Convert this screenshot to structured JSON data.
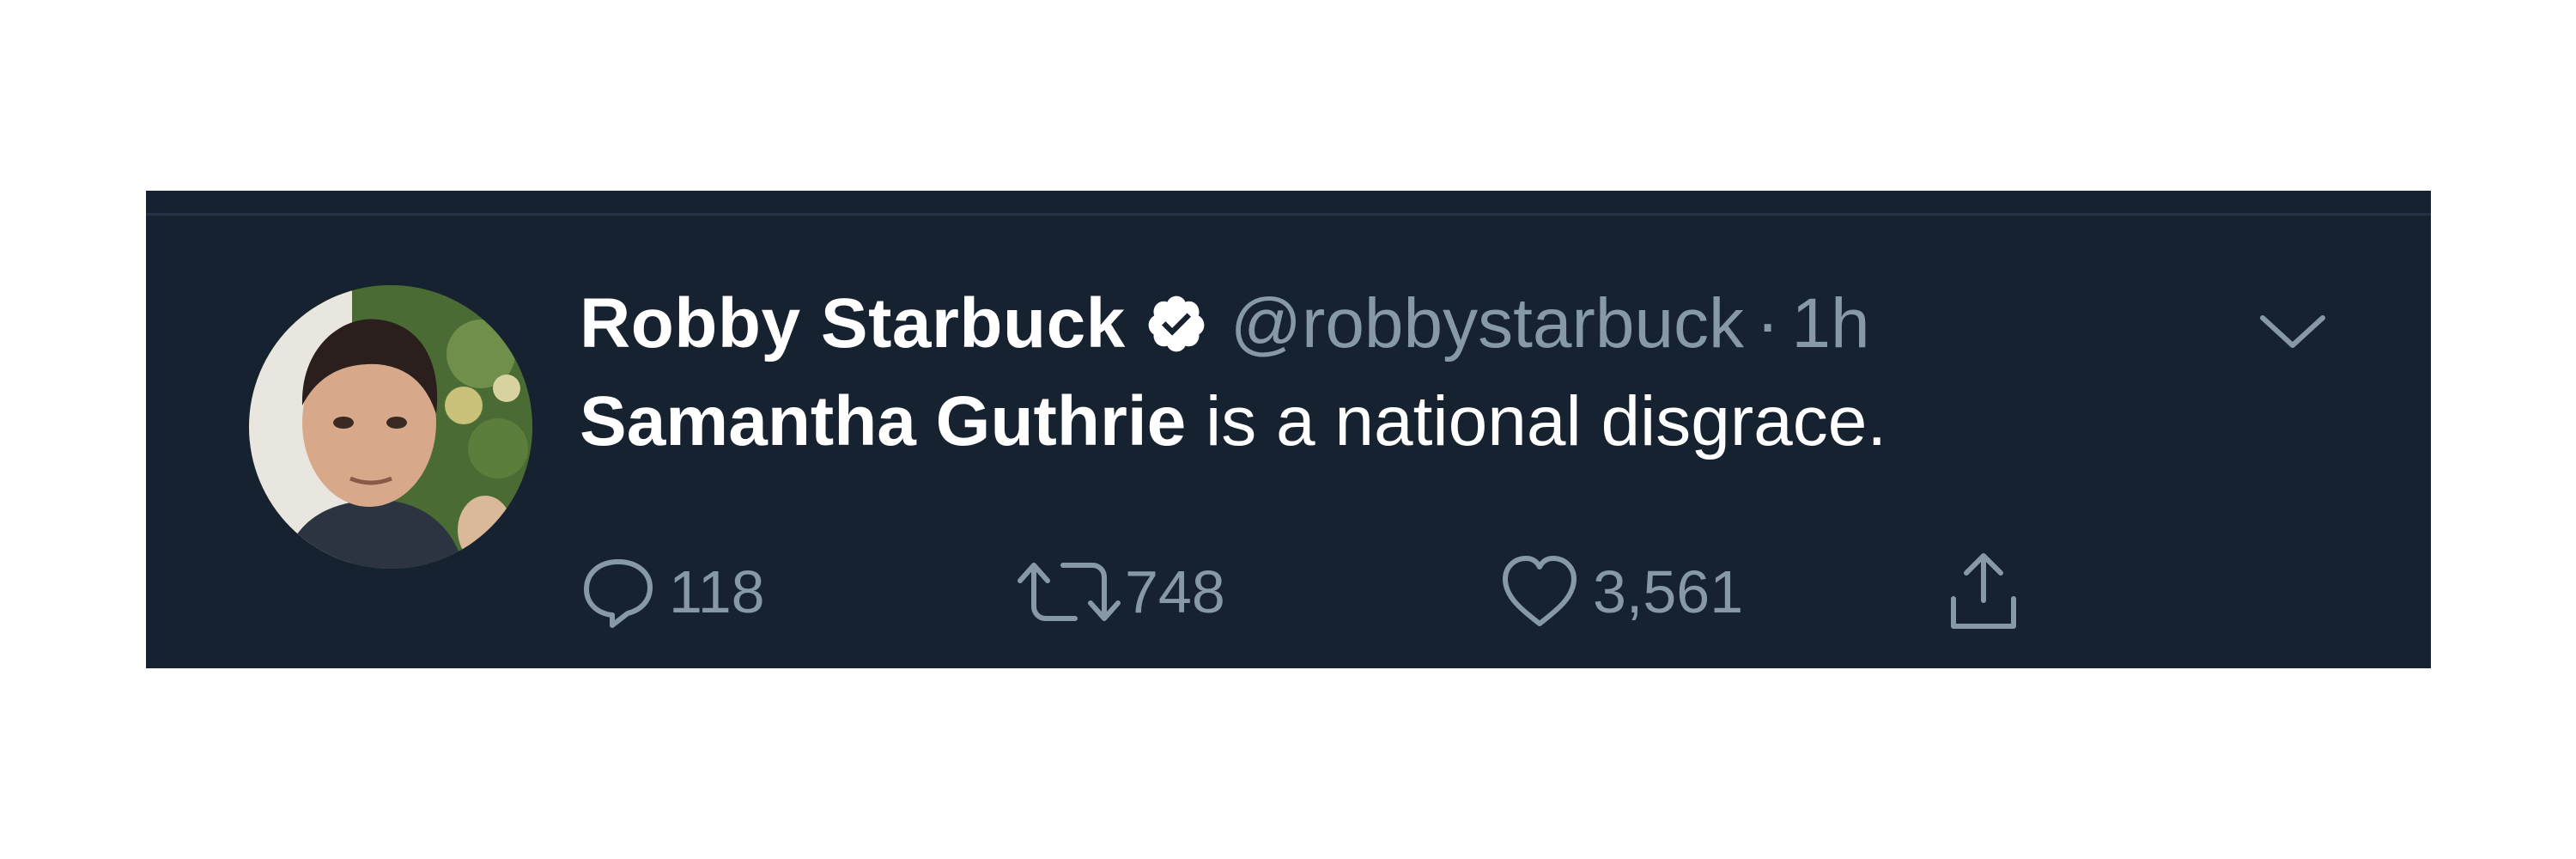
{
  "tweet": {
    "display_name": "Robby Starbuck",
    "handle": "@robbystarbuck",
    "separator": "·",
    "time": "1h",
    "text_mention": "Samantha Guthrie",
    "text_rest": " is a national disgrace.",
    "icons": {
      "verified": "verified-badge-icon",
      "menu": "chevron-down-icon",
      "reply": "reply-icon",
      "retweet": "retweet-icon",
      "like": "heart-icon",
      "share": "share-icon"
    },
    "actions": {
      "replies": "118",
      "retweets": "748",
      "likes": "3,561"
    }
  },
  "colors": {
    "background": "#172230",
    "text_primary": "#ffffff",
    "text_secondary": "#8899a6",
    "page_background": "#ffffff"
  }
}
